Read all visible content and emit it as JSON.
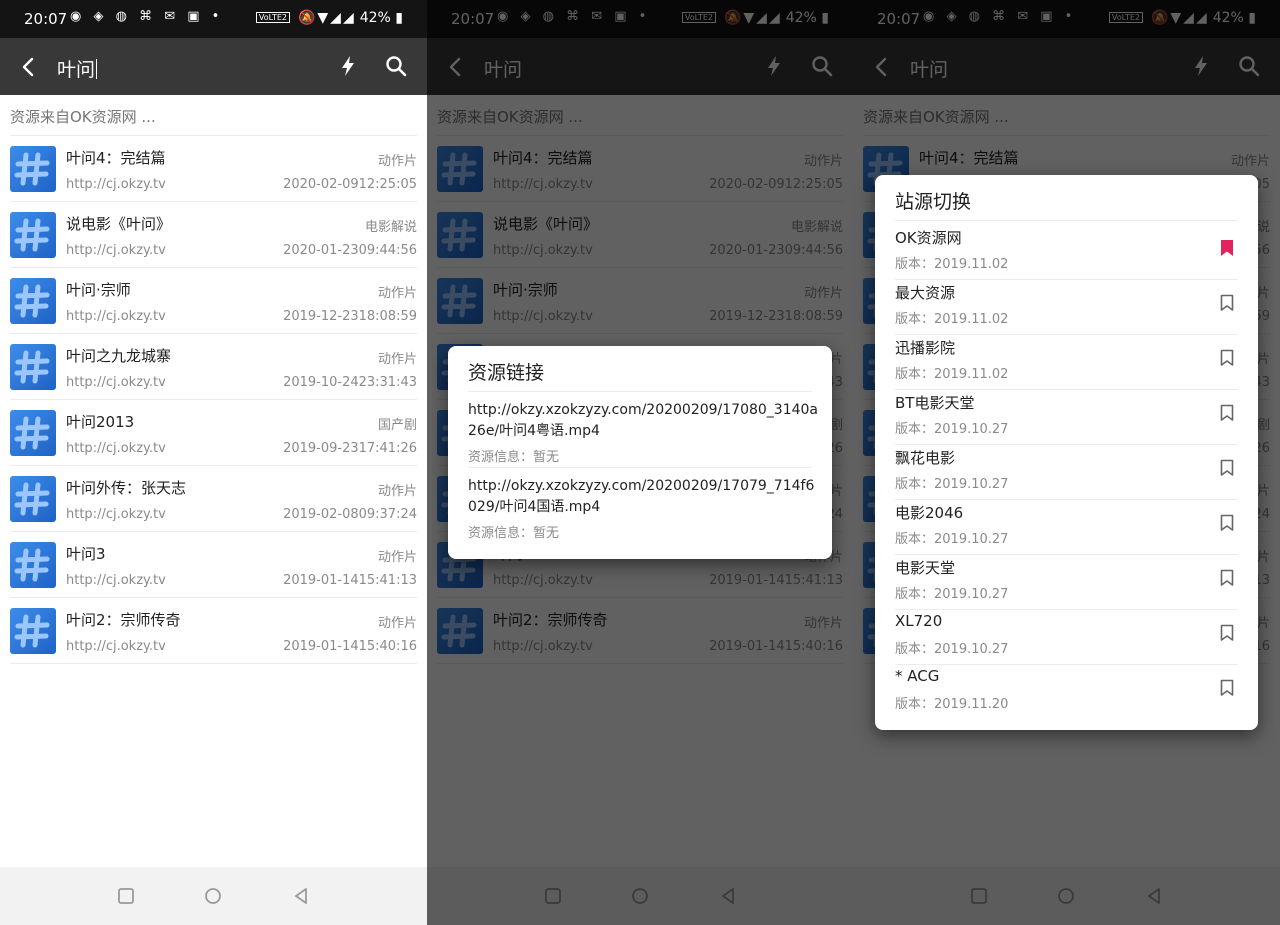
{
  "status_bar": {
    "time": "20:07",
    "battery": "42%",
    "volte": "VoLTE2"
  },
  "search": {
    "query": "叶问"
  },
  "source_hint": "资源来自OK资源网 ...",
  "results": [
    {
      "title": "叶问4：完结篇",
      "url": "http://cj.okzy.tv",
      "category": "动作片",
      "date": "2020-02-0912:25:05"
    },
    {
      "title": "说电影《叶问》",
      "url": "http://cj.okzy.tv",
      "category": "电影解说",
      "date": "2020-01-2309:44:56"
    },
    {
      "title": "叶问·宗师",
      "url": "http://cj.okzy.tv",
      "category": "动作片",
      "date": "2019-12-2318:08:59"
    },
    {
      "title": "叶问之九龙城寨",
      "url": "http://cj.okzy.tv",
      "category": "动作片",
      "date": "2019-10-2423:31:43"
    },
    {
      "title": "叶问2013",
      "url": "http://cj.okzy.tv",
      "category": "国产剧",
      "date": "2019-09-2317:41:26"
    },
    {
      "title": "叶问外传：张天志",
      "url": "http://cj.okzy.tv",
      "category": "动作片",
      "date": "2019-02-0809:37:24"
    },
    {
      "title": "叶问3",
      "url": "http://cj.okzy.tv",
      "category": "动作片",
      "date": "2019-01-1415:41:13"
    },
    {
      "title": "叶问2：宗师传奇",
      "url": "http://cj.okzy.tv",
      "category": "动作片",
      "date": "2019-01-1415:40:16"
    }
  ],
  "link_dialog": {
    "title": "资源链接",
    "links": [
      {
        "url": "http://okzy.xzokzyzy.com/20200209/17080_3140a26e/叶问4粤语.mp4",
        "info": "资源信息：暂无"
      },
      {
        "url": "http://okzy.xzokzyzy.com/20200209/17079_714f6029/叶问4国语.mp4",
        "info": "资源信息：暂无"
      }
    ]
  },
  "source_dialog": {
    "title": "站源切换",
    "sources": [
      {
        "name": "OK资源网",
        "version": "版本：2019.11.02",
        "selected": true
      },
      {
        "name": "最大资源",
        "version": "版本：2019.11.02",
        "selected": false
      },
      {
        "name": "迅播影院",
        "version": "版本：2019.11.02",
        "selected": false
      },
      {
        "name": "BT电影天堂",
        "version": "版本：2019.10.27",
        "selected": false
      },
      {
        "name": "飘花电影",
        "version": "版本：2019.10.27",
        "selected": false
      },
      {
        "name": "电影2046",
        "version": "版本：2019.10.27",
        "selected": false
      },
      {
        "name": "电影天堂",
        "version": "版本：2019.10.27",
        "selected": false
      },
      {
        "name": "XL720",
        "version": "版本：2019.10.27",
        "selected": false
      },
      {
        "name": "* ACG",
        "version": "版本：2019.11.20",
        "selected": false
      }
    ]
  },
  "colors": {
    "toolbar": "#383838",
    "status_bar": "#141414",
    "bookmark_active": "#e0245e",
    "thumb": "#2f7ae0"
  }
}
